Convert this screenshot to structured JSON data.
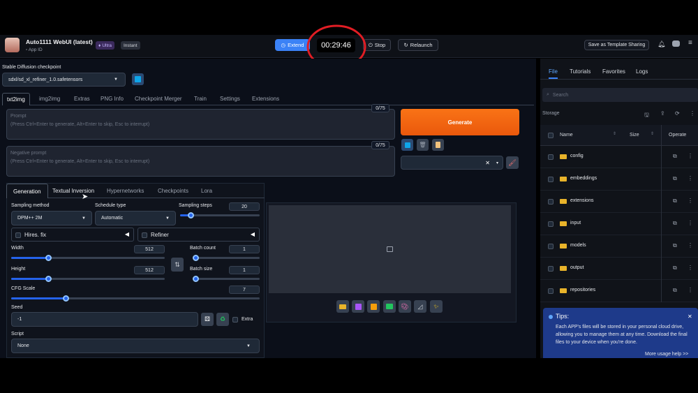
{
  "app": {
    "title": "Auto1111 WebUI (latest)",
    "app_id": "App ID",
    "badge_ultra": "Ultra",
    "badge_instant": "Instant"
  },
  "topbar": {
    "extend": "Extend",
    "timer": "00:29:46",
    "stop": "Stop",
    "relaunch": "Relaunch",
    "save_template": "Save as Template Sharing"
  },
  "checkpoint": {
    "label": "Stable Diffusion checkpoint",
    "value": "sdxl/sd_xl_refiner_1.0.safetensors"
  },
  "tabs": [
    "txt2img",
    "img2img",
    "Extras",
    "PNG Info",
    "Checkpoint Merger",
    "Train",
    "Settings",
    "Extensions"
  ],
  "prompt": {
    "placeholder_title": "Prompt",
    "placeholder_hint": "(Press Ctrl+Enter to generate, Alt+Enter to skip, Esc to interrupt)",
    "counter": "0/75"
  },
  "neg_prompt": {
    "placeholder_title": "Negative prompt",
    "placeholder_hint": "(Press Ctrl+Enter to generate, Alt+Enter to skip, Esc to interrupt)",
    "counter": "0/75"
  },
  "generate": "Generate",
  "subtabs": [
    "Generation",
    "Textual Inversion",
    "Hypernetworks",
    "Checkpoints",
    "Lora"
  ],
  "sampling": {
    "method_label": "Sampling method",
    "method_value": "DPM++ 2M",
    "schedule_label": "Schedule type",
    "schedule_value": "Automatic",
    "steps_label": "Sampling steps",
    "steps_value": "20",
    "steps_fraction": 0.13
  },
  "hires": "Hires. fix",
  "refiner": "Refiner",
  "width": {
    "label": "Width",
    "value": "512",
    "fraction": 0.24
  },
  "height": {
    "label": "Height",
    "value": "512",
    "fraction": 0.24
  },
  "batch_count": {
    "label": "Batch count",
    "value": "1",
    "fraction": 0.0
  },
  "batch_size": {
    "label": "Batch size",
    "value": "1",
    "fraction": 0.0
  },
  "cfg": {
    "label": "CFG Scale",
    "value": "7",
    "fraction": 0.22
  },
  "seed": {
    "label": "Seed",
    "value": "-1",
    "extra": "Extra"
  },
  "script": {
    "label": "Script",
    "value": "None"
  },
  "right": {
    "tabs": [
      "File",
      "Tutorials",
      "Favorites",
      "Logs"
    ],
    "search_placeholder": "Search",
    "storage": "Storage",
    "columns": {
      "name": "Name",
      "size": "Size",
      "operate": "Operate"
    },
    "files": [
      "config",
      "embeddings",
      "extensions",
      "input",
      "models",
      "output",
      "repositories"
    ],
    "tips": {
      "title": "Tips:",
      "body": "Each APP's files will be stored in your personal cloud drive, allowing you to manage them at any time. Download the final files to your device when you're done.",
      "link": "More usage help >>"
    }
  },
  "colors": {
    "accent": "#2563eb",
    "generate": "#f97316",
    "folder": "#e8b32a",
    "timer_circle": "#e11d24"
  }
}
